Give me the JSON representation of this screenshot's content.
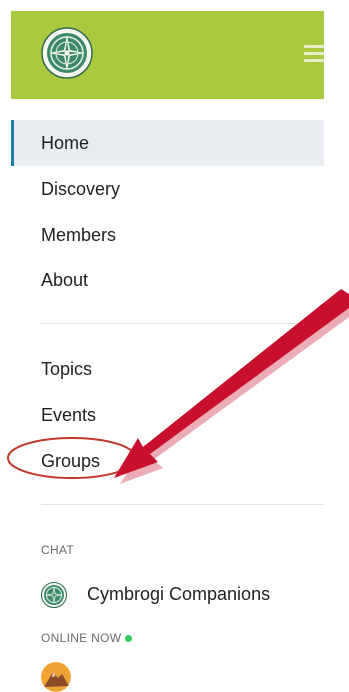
{
  "header": {
    "logo_icon": "compass-logo-icon",
    "menu_icon": "hamburger-menu-icon",
    "background_color": "#a9c93e"
  },
  "nav": {
    "primary": [
      {
        "label": "Home",
        "active": true
      },
      {
        "label": "Discovery",
        "active": false
      },
      {
        "label": "Members",
        "active": false
      },
      {
        "label": "About",
        "active": false
      }
    ],
    "secondary": [
      {
        "label": "Topics"
      },
      {
        "label": "Events"
      },
      {
        "label": "Groups"
      }
    ],
    "active_color": "#1f7fb0"
  },
  "chat": {
    "section_label": "CHAT",
    "items": [
      {
        "name": "Cymbrogi Companions",
        "icon": "compass-logo-icon"
      }
    ]
  },
  "online": {
    "section_label": "ONLINE NOW",
    "status_color": "#2ecc5a",
    "avatars": [
      {
        "icon": "user-avatar"
      }
    ]
  },
  "annotation": {
    "arrow_color": "#c8102e",
    "circle_color": "#c0392b",
    "target": "Groups"
  }
}
